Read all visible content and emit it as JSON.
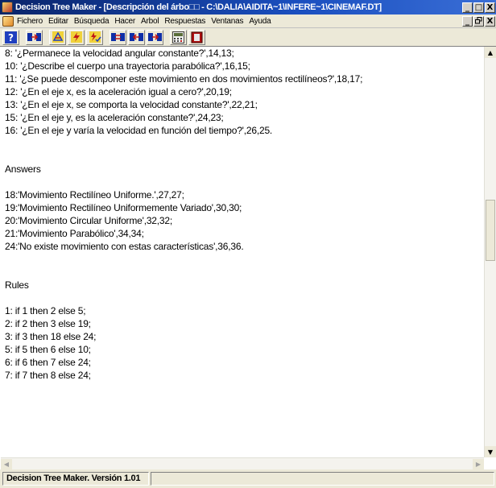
{
  "window": {
    "title": "Decision Tree Maker - [Descripción del árbo□□ - C:\\DALIA\\AIDITA~1\\INFERE~1\\CINEMAF.DT]",
    "buttons": [
      "_",
      "□",
      "X"
    ],
    "mdi_buttons": [
      "_",
      "ə",
      "X"
    ]
  },
  "menu": {
    "items": [
      "Fichero",
      "Editar",
      "Búsqueda",
      "Hacer",
      "Arbol",
      "Respuestas",
      "Ventanas",
      "Ayuda"
    ]
  },
  "toolbar": {
    "buttons": [
      "help-icon",
      "link-tree-icon",
      "inference-icon",
      "lightning-icon",
      "lightning-check-icon",
      "node-link-icon",
      "node-swap-icon",
      "node-join-icon",
      "calculator-icon",
      "stop-icon"
    ]
  },
  "document": {
    "lines": [
      "8: '¿Permanece la velocidad angular constante?',14,13;",
      "10: '¿Describe el cuerpo una trayectoria parabólica?',16,15;",
      "11: '¿Se puede descomponer este movimiento en dos movimientos rectilíneos?',18,17;",
      "12: '¿En el eje x, es la aceleración igual a cero?',20,19;",
      "13: '¿En el eje x, se comporta la velocidad constante?',22,21;",
      "15: '¿En el eje y, es la aceleración constante?',24,23;",
      "16: '¿En el eje y varía la velocidad en función del tiempo?',26,25.",
      "",
      "",
      "Answers",
      "",
      "18:'Movimiento Rectilíneo Uniforme.',27,27;",
      "19:'Movimiento Rectilíneo Uniformemente Variado',30,30;",
      "20:'Movimiento Circular Uniforme',32,32;",
      "21:'Movimiento Parabólico',34,34;",
      "24:'No existe movimiento con estas características',36,36.",
      "",
      "",
      "Rules",
      "",
      "1: if 1 then 2 else 5;",
      "2: if 2 then 3 else 19;",
      "3: if 3 then 18 else 24;",
      "5: if 5 then 6 else 10;",
      "6: if 6 then 7 else 24;",
      "7: if 7 then 8 else 24;"
    ]
  },
  "statusbar": {
    "text": "Decision Tree Maker. Versión 1.01",
    "second": ""
  }
}
